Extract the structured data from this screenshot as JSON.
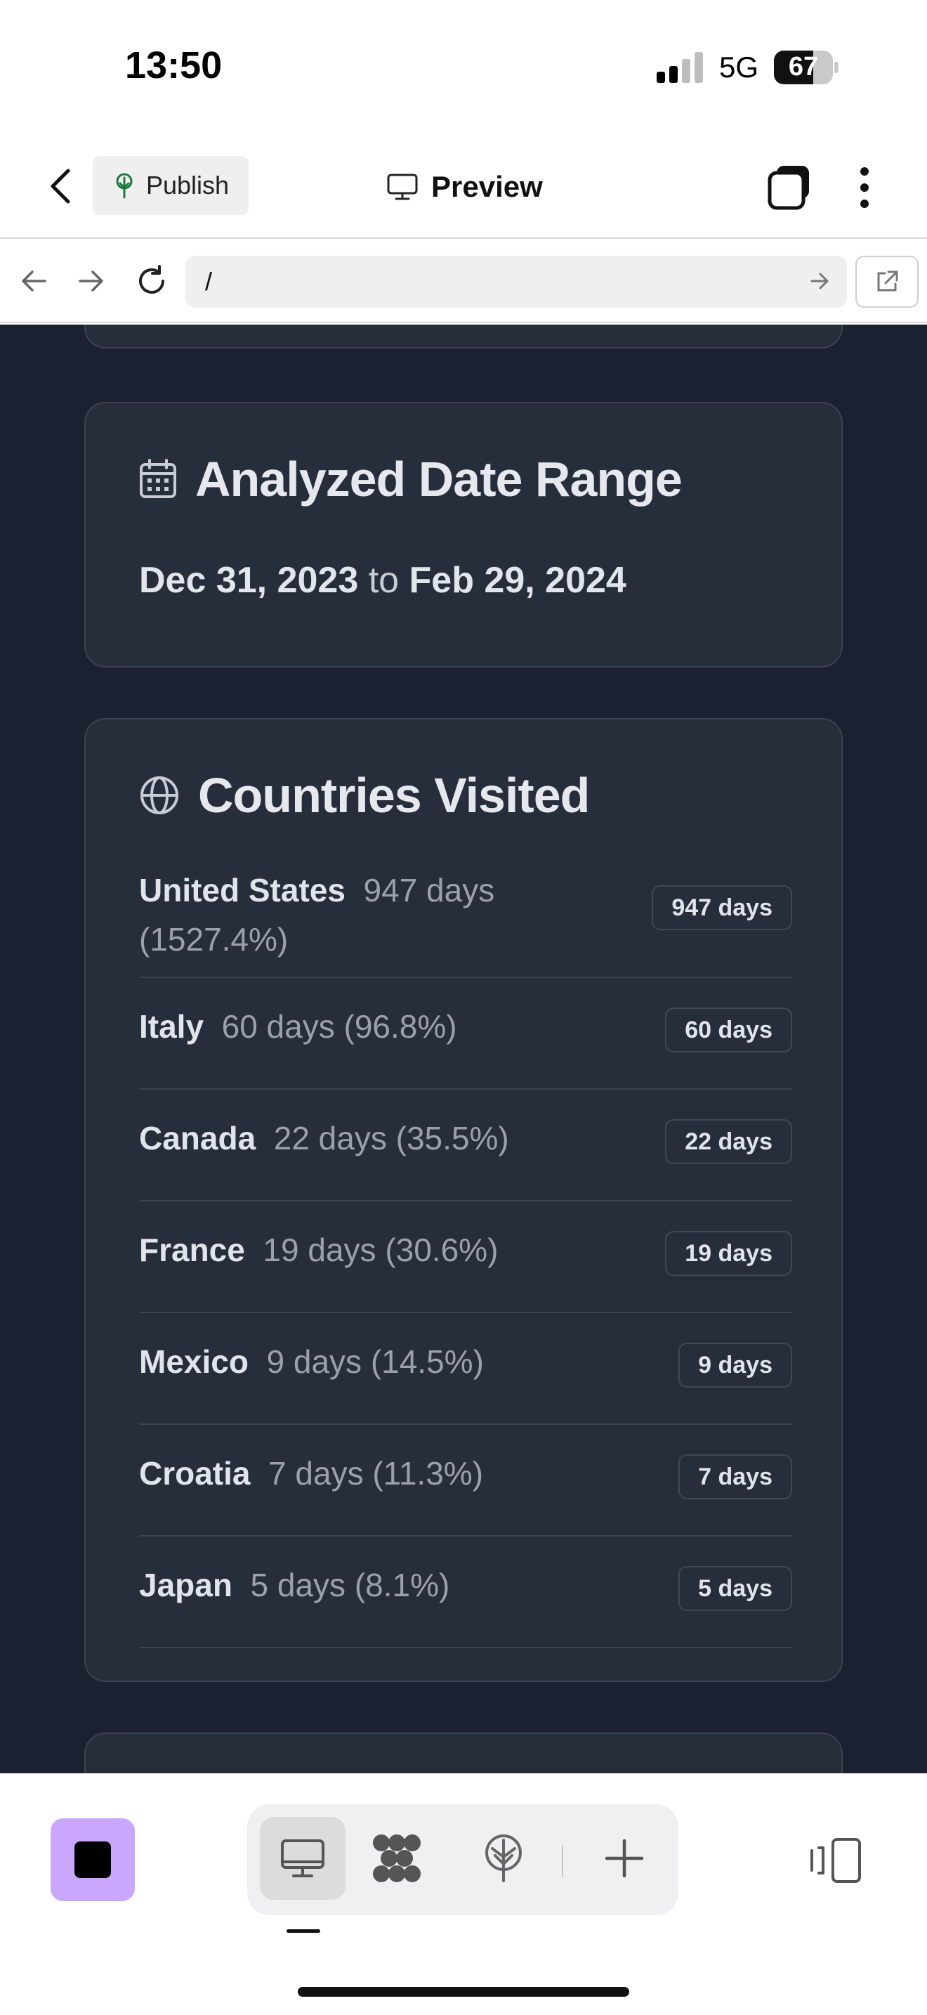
{
  "status_bar": {
    "time": "13:50",
    "network": "5G",
    "battery": "67",
    "battery_level": 0.67
  },
  "header": {
    "publish_label": "Publish",
    "preview_label": "Preview"
  },
  "url_bar": {
    "url": "/"
  },
  "date_card": {
    "title": "Analyzed Date Range",
    "start": "Dec 31, 2023",
    "connector": "to",
    "end": "Feb 29, 2024"
  },
  "countries_card": {
    "title": "Countries Visited",
    "rows": [
      {
        "name": "United States",
        "detail_line1": "947 days",
        "detail_line2": "(1527.4%)",
        "badge": "947 days"
      },
      {
        "name": "Italy",
        "detail": "60 days (96.8%)",
        "badge": "60 days"
      },
      {
        "name": "Canada",
        "detail": "22 days (35.5%)",
        "badge": "22 days"
      },
      {
        "name": "France",
        "detail": "19 days (30.6%)",
        "badge": "19 days"
      },
      {
        "name": "Mexico",
        "detail": "9 days (14.5%)",
        "badge": "9 days"
      },
      {
        "name": "Croatia",
        "detail": "7 days (11.3%)",
        "badge": "7 days"
      },
      {
        "name": "Japan",
        "detail": "5 days (8.1%)",
        "badge": "5 days"
      }
    ]
  },
  "colors": {
    "page_bg": "#1b2130",
    "card_bg": "#262d3b",
    "accent": "#c9a7ff"
  },
  "icons": {
    "back": "chevron-left-icon",
    "publish": "tree-icon",
    "preview": "monitor-icon",
    "calendar": "calendar-icon",
    "globe": "globe-icon"
  }
}
